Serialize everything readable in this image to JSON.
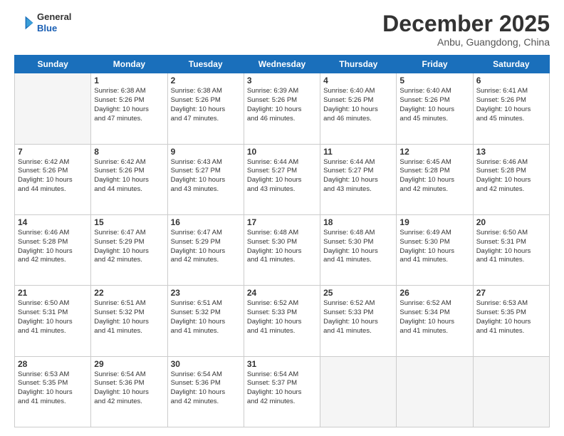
{
  "header": {
    "logo": {
      "line1": "General",
      "line2": "Blue"
    },
    "title": "December 2025",
    "location": "Anbu, Guangdong, China"
  },
  "weekdays": [
    "Sunday",
    "Monday",
    "Tuesday",
    "Wednesday",
    "Thursday",
    "Friday",
    "Saturday"
  ],
  "weeks": [
    [
      {
        "day": null,
        "info": null
      },
      {
        "day": "1",
        "info": "Sunrise: 6:38 AM\nSunset: 5:26 PM\nDaylight: 10 hours\nand 47 minutes."
      },
      {
        "day": "2",
        "info": "Sunrise: 6:38 AM\nSunset: 5:26 PM\nDaylight: 10 hours\nand 47 minutes."
      },
      {
        "day": "3",
        "info": "Sunrise: 6:39 AM\nSunset: 5:26 PM\nDaylight: 10 hours\nand 46 minutes."
      },
      {
        "day": "4",
        "info": "Sunrise: 6:40 AM\nSunset: 5:26 PM\nDaylight: 10 hours\nand 46 minutes."
      },
      {
        "day": "5",
        "info": "Sunrise: 6:40 AM\nSunset: 5:26 PM\nDaylight: 10 hours\nand 45 minutes."
      },
      {
        "day": "6",
        "info": "Sunrise: 6:41 AM\nSunset: 5:26 PM\nDaylight: 10 hours\nand 45 minutes."
      }
    ],
    [
      {
        "day": "7",
        "info": "Sunrise: 6:42 AM\nSunset: 5:26 PM\nDaylight: 10 hours\nand 44 minutes."
      },
      {
        "day": "8",
        "info": "Sunrise: 6:42 AM\nSunset: 5:26 PM\nDaylight: 10 hours\nand 44 minutes."
      },
      {
        "day": "9",
        "info": "Sunrise: 6:43 AM\nSunset: 5:27 PM\nDaylight: 10 hours\nand 43 minutes."
      },
      {
        "day": "10",
        "info": "Sunrise: 6:44 AM\nSunset: 5:27 PM\nDaylight: 10 hours\nand 43 minutes."
      },
      {
        "day": "11",
        "info": "Sunrise: 6:44 AM\nSunset: 5:27 PM\nDaylight: 10 hours\nand 43 minutes."
      },
      {
        "day": "12",
        "info": "Sunrise: 6:45 AM\nSunset: 5:28 PM\nDaylight: 10 hours\nand 42 minutes."
      },
      {
        "day": "13",
        "info": "Sunrise: 6:46 AM\nSunset: 5:28 PM\nDaylight: 10 hours\nand 42 minutes."
      }
    ],
    [
      {
        "day": "14",
        "info": "Sunrise: 6:46 AM\nSunset: 5:28 PM\nDaylight: 10 hours\nand 42 minutes."
      },
      {
        "day": "15",
        "info": "Sunrise: 6:47 AM\nSunset: 5:29 PM\nDaylight: 10 hours\nand 42 minutes."
      },
      {
        "day": "16",
        "info": "Sunrise: 6:47 AM\nSunset: 5:29 PM\nDaylight: 10 hours\nand 42 minutes."
      },
      {
        "day": "17",
        "info": "Sunrise: 6:48 AM\nSunset: 5:30 PM\nDaylight: 10 hours\nand 41 minutes."
      },
      {
        "day": "18",
        "info": "Sunrise: 6:48 AM\nSunset: 5:30 PM\nDaylight: 10 hours\nand 41 minutes."
      },
      {
        "day": "19",
        "info": "Sunrise: 6:49 AM\nSunset: 5:30 PM\nDaylight: 10 hours\nand 41 minutes."
      },
      {
        "day": "20",
        "info": "Sunrise: 6:50 AM\nSunset: 5:31 PM\nDaylight: 10 hours\nand 41 minutes."
      }
    ],
    [
      {
        "day": "21",
        "info": "Sunrise: 6:50 AM\nSunset: 5:31 PM\nDaylight: 10 hours\nand 41 minutes."
      },
      {
        "day": "22",
        "info": "Sunrise: 6:51 AM\nSunset: 5:32 PM\nDaylight: 10 hours\nand 41 minutes."
      },
      {
        "day": "23",
        "info": "Sunrise: 6:51 AM\nSunset: 5:32 PM\nDaylight: 10 hours\nand 41 minutes."
      },
      {
        "day": "24",
        "info": "Sunrise: 6:52 AM\nSunset: 5:33 PM\nDaylight: 10 hours\nand 41 minutes."
      },
      {
        "day": "25",
        "info": "Sunrise: 6:52 AM\nSunset: 5:33 PM\nDaylight: 10 hours\nand 41 minutes."
      },
      {
        "day": "26",
        "info": "Sunrise: 6:52 AM\nSunset: 5:34 PM\nDaylight: 10 hours\nand 41 minutes."
      },
      {
        "day": "27",
        "info": "Sunrise: 6:53 AM\nSunset: 5:35 PM\nDaylight: 10 hours\nand 41 minutes."
      }
    ],
    [
      {
        "day": "28",
        "info": "Sunrise: 6:53 AM\nSunset: 5:35 PM\nDaylight: 10 hours\nand 41 minutes."
      },
      {
        "day": "29",
        "info": "Sunrise: 6:54 AM\nSunset: 5:36 PM\nDaylight: 10 hours\nand 42 minutes."
      },
      {
        "day": "30",
        "info": "Sunrise: 6:54 AM\nSunset: 5:36 PM\nDaylight: 10 hours\nand 42 minutes."
      },
      {
        "day": "31",
        "info": "Sunrise: 6:54 AM\nSunset: 5:37 PM\nDaylight: 10 hours\nand 42 minutes."
      },
      {
        "day": null,
        "info": null
      },
      {
        "day": null,
        "info": null
      },
      {
        "day": null,
        "info": null
      }
    ]
  ]
}
